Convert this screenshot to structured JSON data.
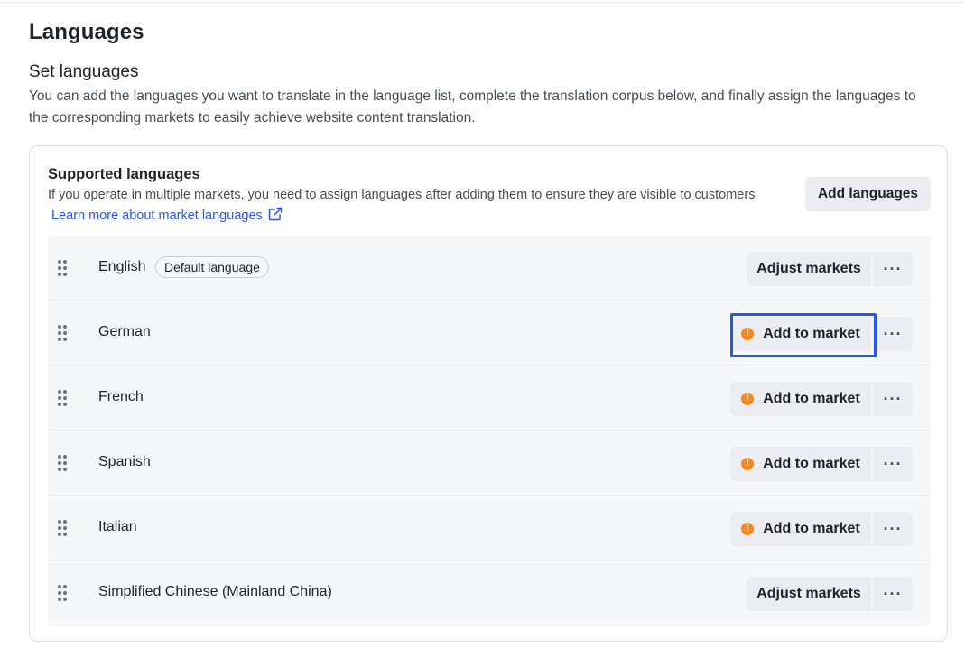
{
  "page": {
    "title": "Languages",
    "section_title": "Set languages",
    "section_description": "You can add the languages you want to translate in the language list, complete the translation corpus below, and finally assign the languages to the corresponding markets to easily achieve website content translation."
  },
  "card": {
    "title": "Supported languages",
    "description": "If you operate in multiple markets, you need to assign languages after adding them to ensure they are visible to customers",
    "learn_more_link": "Learn more about market languages",
    "add_languages_button": "Add languages"
  },
  "languages": [
    {
      "name": "English",
      "badge": "Default language",
      "action": "Adjust markets",
      "warning": false
    },
    {
      "name": "German",
      "badge": "",
      "action": "Add to market",
      "warning": true
    },
    {
      "name": "French",
      "badge": "",
      "action": "Add to market",
      "warning": true
    },
    {
      "name": "Spanish",
      "badge": "",
      "action": "Add to market",
      "warning": true
    },
    {
      "name": "Italian",
      "badge": "",
      "action": "Add to market",
      "warning": true
    },
    {
      "name": "Simplified Chinese (Mainland China)",
      "badge": "",
      "action": "Adjust markets",
      "warning": false
    }
  ],
  "more_button_label": "···",
  "warning_icon_glyph": "!",
  "colors": {
    "accent": "#2457f5",
    "warning": "#f5891c",
    "button_bg": "#ebedf2",
    "list_bg": "#f6f7f9"
  },
  "icons": {
    "drag": "drag-handle-icon",
    "external": "external-link-icon",
    "warning": "warning-dot-icon",
    "more": "more-options-icon"
  }
}
